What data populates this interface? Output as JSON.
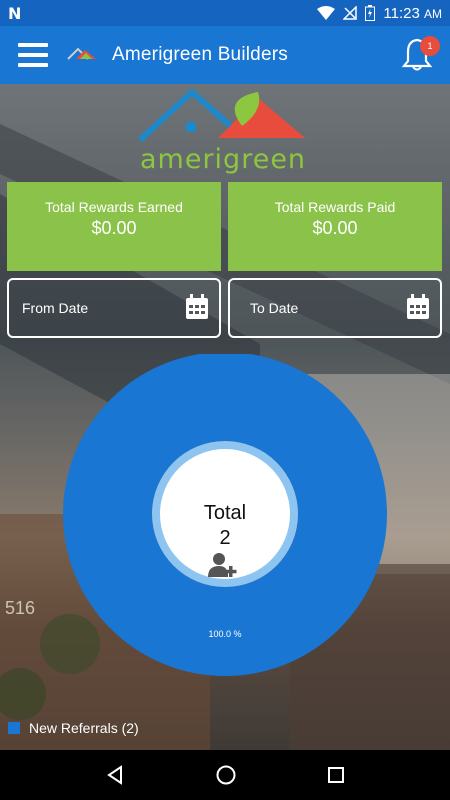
{
  "status_bar": {
    "left_icon": "N",
    "time": "11:23",
    "ampm": "AM",
    "icons": [
      "wifi-icon",
      "signal-off-icon",
      "battery-icon"
    ]
  },
  "app_bar": {
    "menu_icon": "hamburger-menu-icon",
    "title": "Amerigreen Builders",
    "notification_icon": "bell-icon",
    "notification_count": "1"
  },
  "brand": {
    "logo_text": "amerigreen"
  },
  "rewards": {
    "earned_label": "Total Rewards Earned",
    "earned_value": "$0.00",
    "paid_label": "Total Rewards Paid",
    "paid_value": "$0.00"
  },
  "filters": {
    "from_date_label": "From Date",
    "to_date_label": "To Date",
    "calendar_icon": "calendar-icon"
  },
  "chart_data": {
    "type": "pie",
    "center_label": "Total",
    "center_value": "2",
    "center_icon": "add-user-icon",
    "slices": [
      {
        "name": "New Referrals",
        "value": 2,
        "percent_label": "100.0 %",
        "color": "#1976d2"
      }
    ],
    "legend": {
      "placement": "bottom-left",
      "entries": [
        "New Referrals (2)"
      ]
    }
  },
  "nav_bar": {
    "icons": [
      "back-icon",
      "home-icon",
      "recents-icon"
    ]
  },
  "colors": {
    "status_bar": "#1565c0",
    "app_bar": "#1976d2",
    "reward_box": "#8bc34a",
    "donut": "#1976d2",
    "badge": "#e84c3d"
  }
}
